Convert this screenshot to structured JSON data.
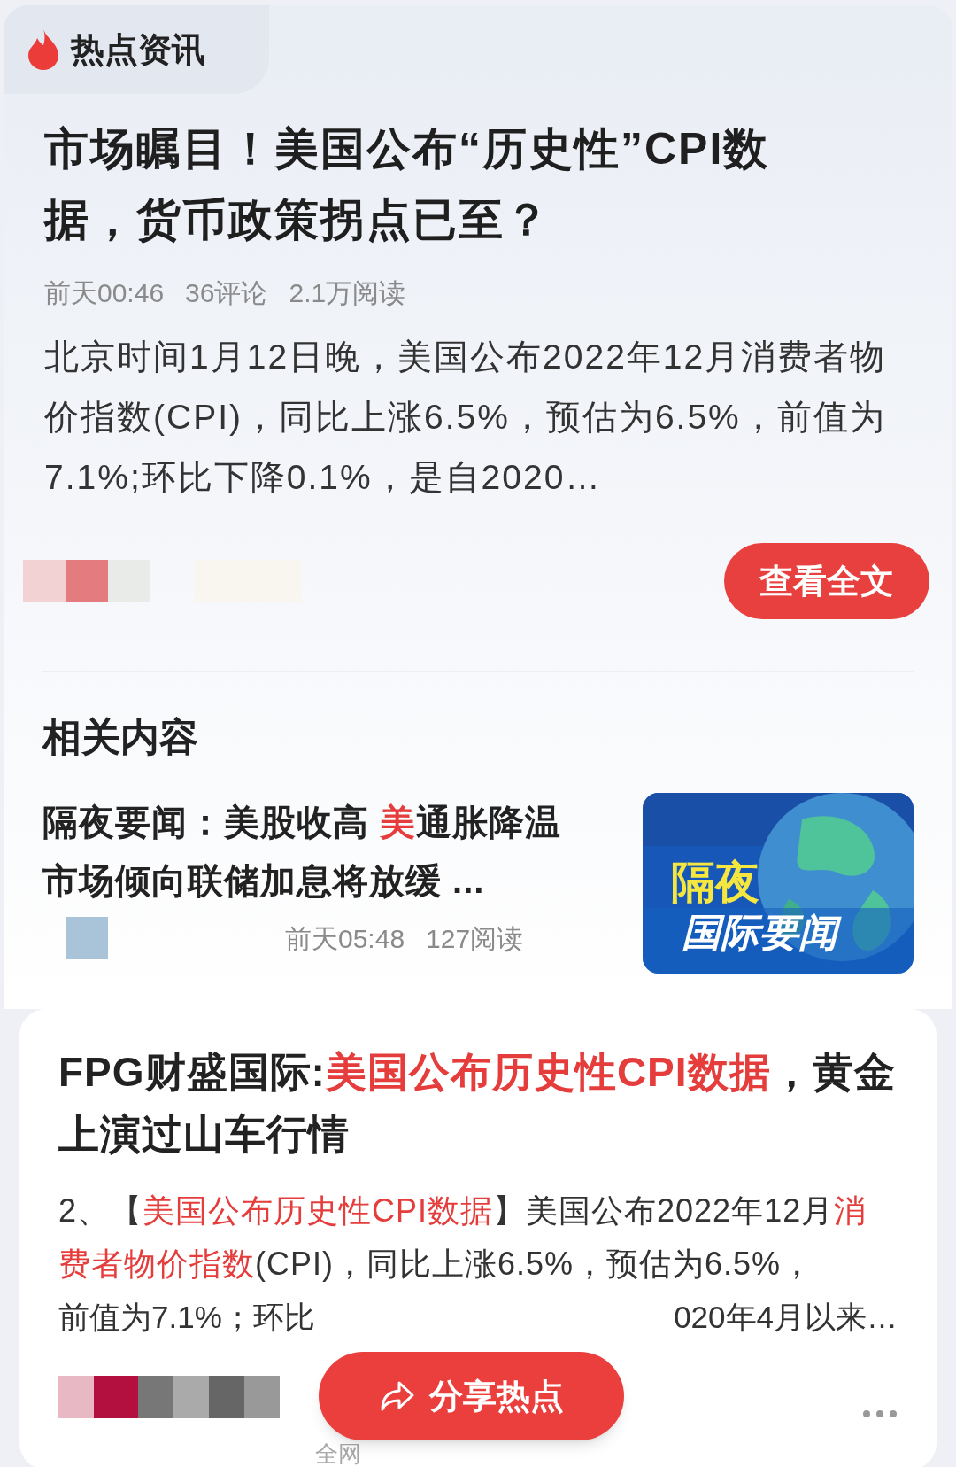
{
  "header": {
    "title": "热点资讯"
  },
  "article": {
    "title": "市场瞩目！美国公布“历史性”CPI数据，货币政策拐点已至？",
    "meta": [
      "前天00:46",
      "36评论",
      "2.1万阅读"
    ],
    "summary": "北京时间1月12日晚，美国公布2022年12月消费者物价指数(CPI)，同比上涨6.5%，预估为6.5%，前值为7.1%;环比下降0.1%，是自2020…",
    "read_button": "查看全文"
  },
  "related": {
    "heading": "相关内容",
    "items": [
      {
        "title": [
          {
            "text": "隔夜要闻：美股收高 ",
            "highlight": false
          },
          {
            "text": "美",
            "highlight": true
          },
          {
            "text": "通胀降温市场倾向联储加息将放缓 ...",
            "highlight": false
          }
        ],
        "meta": [
          "前天05:48",
          "127阅读"
        ],
        "thumbnail": {
          "line_1": "隔夜",
          "line_2": "国际要闻"
        }
      }
    ]
  },
  "card": {
    "title": [
      {
        "text": "FPG财盛国际:",
        "highlight": false
      },
      {
        "text": "美国公布历史性CPI数据",
        "highlight": true
      },
      {
        "text": "，黄金上演过山车行情",
        "highlight": false
      }
    ],
    "body": [
      {
        "text": "2、【",
        "highlight": false
      },
      {
        "text": "美国公布历史性CPI数据",
        "highlight": true
      },
      {
        "text": "】美国公布2022年12月",
        "highlight": false
      },
      {
        "text": "消费者物价指数",
        "highlight": true
      },
      {
        "text": "(CPI)，同比上涨6.5%，预估为6.5%，",
        "highlight": false
      }
    ],
    "body_tail_left": "前值为7.1%；环比",
    "body_tail_right": "020年4月以来…",
    "source": "全网"
  },
  "share_button": "分享热点"
}
